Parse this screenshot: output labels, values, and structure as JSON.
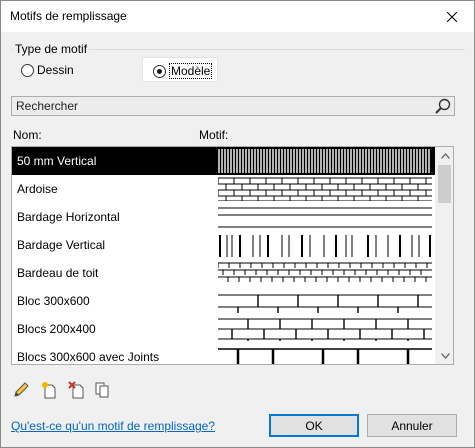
{
  "window": {
    "title": "Motifs de remplissage"
  },
  "pattern_type": {
    "label": "Type de motif",
    "options": [
      {
        "label": "Dessin",
        "selected": false
      },
      {
        "label": "Modèle",
        "selected": true
      }
    ]
  },
  "search": {
    "placeholder": "Rechercher"
  },
  "columns": {
    "name": "Nom:",
    "pattern": "Motif:"
  },
  "patterns": [
    {
      "name": "50 mm Vertical",
      "selected": true,
      "icon": "dense-vertical-lines"
    },
    {
      "name": "Ardoise",
      "selected": false,
      "icon": "brick-slate"
    },
    {
      "name": "Bardage Horizontal",
      "selected": false,
      "icon": "horizontal-lines"
    },
    {
      "name": "Bardage Vertical",
      "selected": false,
      "icon": "vertical-siding"
    },
    {
      "name": "Bardeau de toit",
      "selected": false,
      "icon": "shingles"
    },
    {
      "name": "Bloc 300x600",
      "selected": false,
      "icon": "block-joints"
    },
    {
      "name": "Blocs 200x400",
      "selected": false,
      "icon": "block-joints-small"
    },
    {
      "name": "Blocs 300x600 avec Joints",
      "selected": false,
      "icon": "block-joints-thick"
    }
  ],
  "toolbar": {
    "edit": "pencil-icon",
    "new": "new-pattern-icon",
    "delete": "delete-pattern-icon",
    "duplicate": "duplicate-pattern-icon"
  },
  "footer": {
    "help_link": "Qu'est-ce qu'un motif de remplissage?",
    "ok": "OK",
    "cancel": "Annuler"
  },
  "colors": {
    "accent": "#0078d7",
    "link": "#0066cc",
    "selection": "#000000"
  }
}
